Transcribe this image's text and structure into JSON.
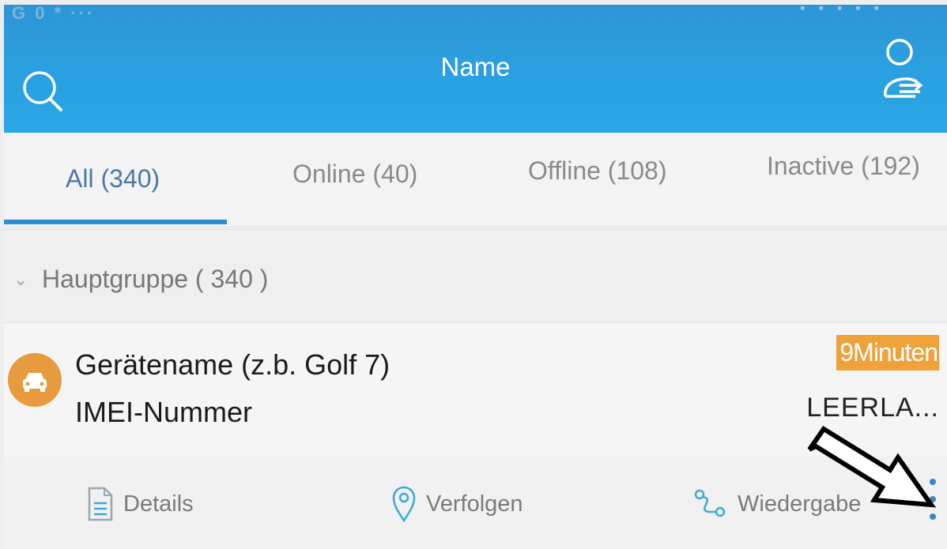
{
  "status_bar": {
    "left_icons": "G 0 * ···"
  },
  "header": {
    "title": "Name",
    "search_icon": "search-icon",
    "user_icon": "user-switch-icon"
  },
  "tabs": [
    {
      "label": "All (340)",
      "active": true
    },
    {
      "label": "Online (40)",
      "active": false
    },
    {
      "label": "Offline (108)",
      "active": false
    },
    {
      "label": "Inactive (192)",
      "active": false
    }
  ],
  "group": {
    "label": "Hauptgruppe ( 340 )",
    "expanded": true
  },
  "device": {
    "name": "Gerätename (z.b. Golf 7)",
    "imei": "IMEI-Nummer",
    "time_badge": "9Minuten",
    "status": "LEERLA...",
    "avatar_icon": "car-icon"
  },
  "actions": [
    {
      "label": "Details",
      "icon": "document-icon"
    },
    {
      "label": "Verfolgen",
      "icon": "location-pin-icon"
    },
    {
      "label": "Wiedergabe",
      "icon": "route-icon"
    }
  ],
  "more_icon": "more-vertical-icon",
  "colors": {
    "header_bg": "#2aa0e0",
    "tab_active": "#4a78a8",
    "indicator": "#2d8fd0",
    "badge_bg": "#f0a23a",
    "avatar_bg": "#e89a3e",
    "action_icon": "#3aa9d8"
  }
}
